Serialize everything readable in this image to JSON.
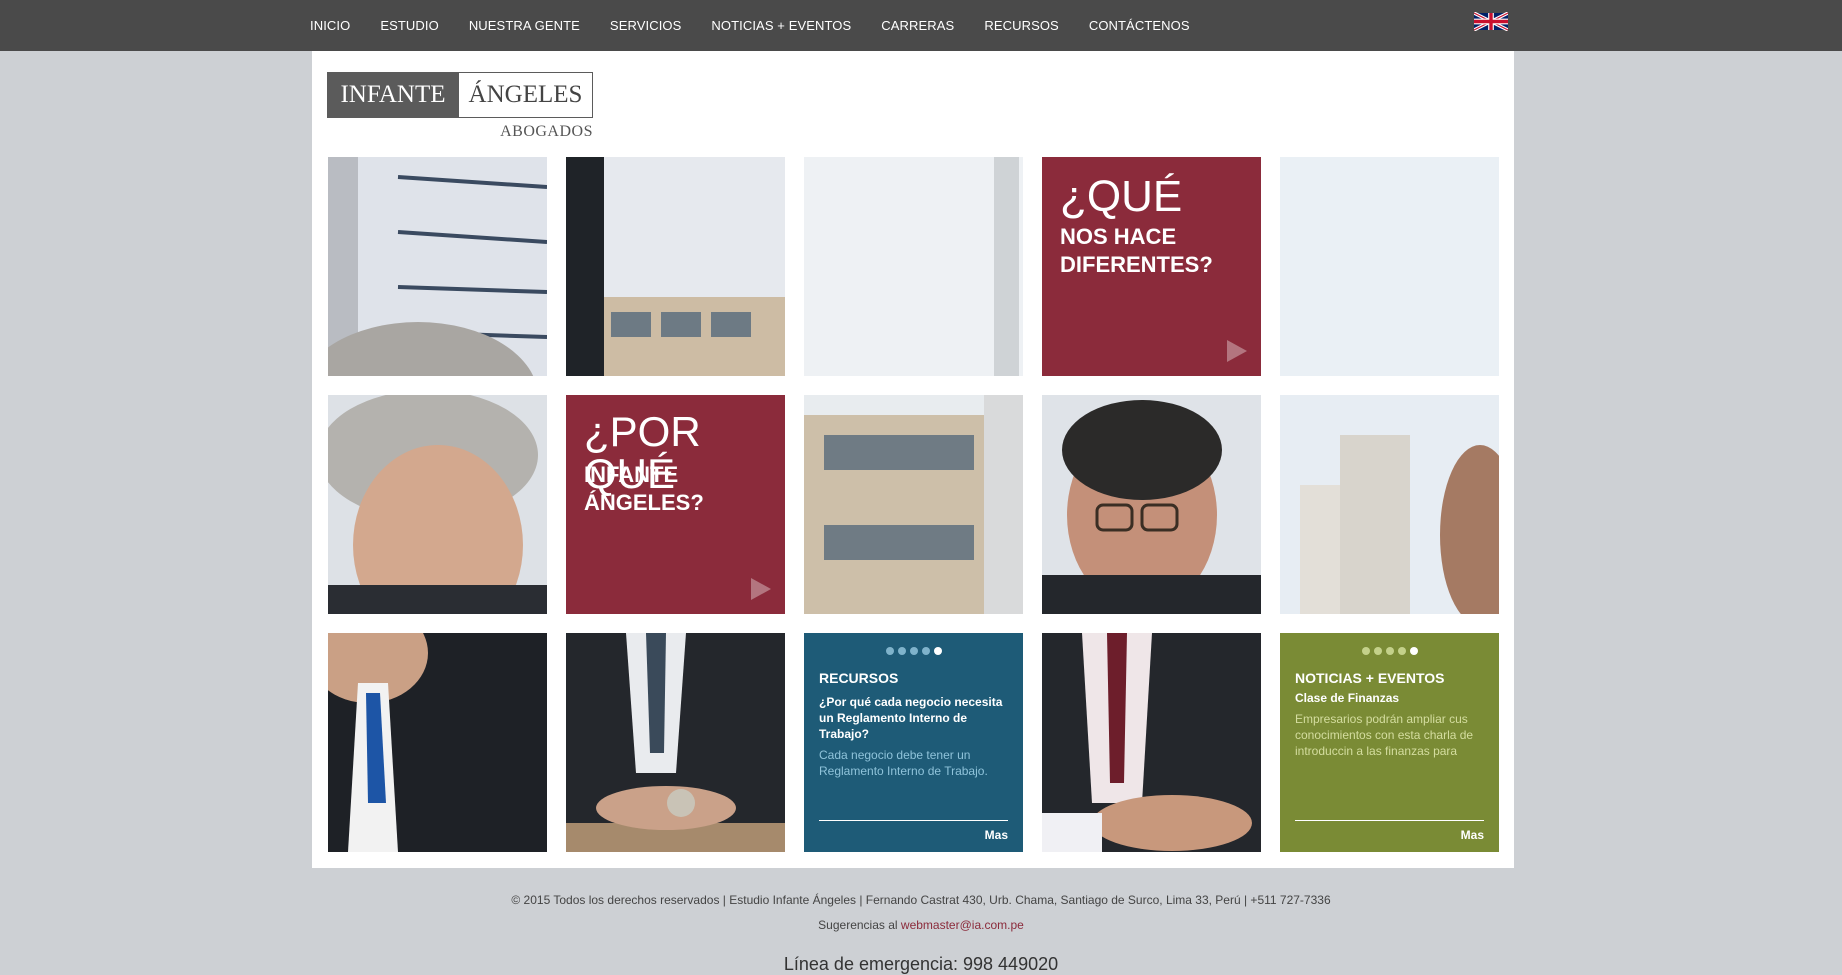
{
  "nav": {
    "items": [
      "INICIO",
      "ESTUDIO",
      "NUESTRA GENTE",
      "SERVICIOS",
      "NOTICIAS + EVENTOS",
      "CARRERAS",
      "RECURSOS",
      "CONTÁCTENOS"
    ],
    "language_icon": "uk-flag-icon"
  },
  "logo": {
    "part1": "INFANTE",
    "part2": "ÁNGELES",
    "part3": "ABOGADOS"
  },
  "tiles": {
    "que_big": "¿QUÉ",
    "que_line1": "NOS HACE",
    "que_line2": "DIFERENTES?",
    "porque_big": "¿POR QUÉ",
    "porque_line1": "INFANTE",
    "porque_line2": "ÁNGELES?"
  },
  "recursos": {
    "title": "RECURSOS",
    "subtitle": "¿Por qué cada negocio necesita un Reglamento Interno de Trabajo?",
    "description": "Cada negocio debe tener un Reglamento Interno de Trabajo.",
    "more": "Mas"
  },
  "noticias": {
    "title": "NOTICIAS + EVENTOS",
    "subtitle": "Clase de Finanzas",
    "description": "Empresarios podrán ampliar cus conocimientos con esta charla de introduccin a las finanzas para",
    "more": "Mas"
  },
  "footer": {
    "copyright": "© 2015 Todos los derechos reservados | Estudio Infante Ángeles | Fernando Castrat 430, Urb. Chama, Santiago de Surco, Lima 33, Perú | +511 727-7336",
    "suggest_label": "Sugerencias al",
    "email": "webmaster@ia.com.pe",
    "emergency": "Línea de emergencia: 998 449020"
  },
  "colors": {
    "red": "#8b2b3b",
    "teal": "#1e5b77",
    "olive": "#7a8b35",
    "nav_bg": "#4a4a4a"
  }
}
